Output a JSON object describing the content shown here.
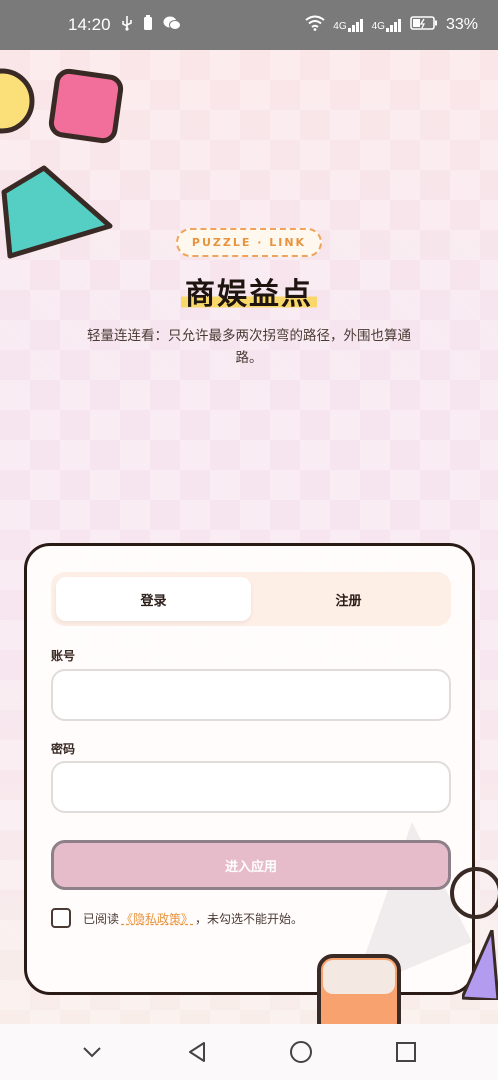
{
  "status_bar": {
    "time": "14:20",
    "network_a": "4G",
    "network_b": "4G",
    "battery": "33%"
  },
  "hero": {
    "badge": "PUZZLE · LINK",
    "title": "商娱益点",
    "subtitle": "轻量连连看：只允许最多两次拐弯的路径，外围也算通路。"
  },
  "auth": {
    "tabs": [
      {
        "label": "登录",
        "active": true
      },
      {
        "label": "注册",
        "active": false
      }
    ],
    "account_label": "账号",
    "account_value": "",
    "password_label": "密码",
    "password_value": "",
    "submit_label": "进入应用",
    "agree_prefix": "已阅读",
    "policy_link": "《隐私政策》",
    "agree_suffix": "，未勾选不能开始。",
    "agree_checked": false
  },
  "colors": {
    "accent_orange": "#e8943f",
    "title_highlight": "#f9d86b",
    "submit_bg": "#e6bccb",
    "yellow_shape": "#fbe07a",
    "pink_shape": "#f26f9b",
    "teal_shape": "#55cfc4",
    "orange_shape": "#f8a36f",
    "purple_shape": "#b39cf0"
  },
  "nav_bar": {
    "icons": [
      "chevron-down-icon",
      "back-icon",
      "home-icon",
      "recents-icon"
    ]
  }
}
